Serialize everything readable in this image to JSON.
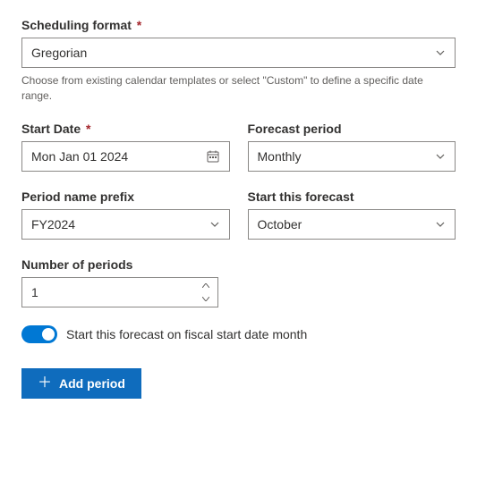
{
  "schedulingFormat": {
    "label": "Scheduling format",
    "required": "*",
    "value": "Gregorian",
    "helper": "Choose from existing calendar templates or select \"Custom\" to define a specific date range."
  },
  "startDate": {
    "label": "Start Date",
    "required": "*",
    "value": "Mon Jan 01 2024"
  },
  "forecastPeriod": {
    "label": "Forecast period",
    "value": "Monthly"
  },
  "periodPrefix": {
    "label": "Period name prefix",
    "value": "FY2024"
  },
  "startForecast": {
    "label": "Start this forecast",
    "value": "October"
  },
  "numPeriods": {
    "label": "Number of periods",
    "value": "1"
  },
  "fiscalToggle": {
    "label": "Start this forecast on fiscal start date month"
  },
  "addPeriod": {
    "label": "Add period"
  }
}
